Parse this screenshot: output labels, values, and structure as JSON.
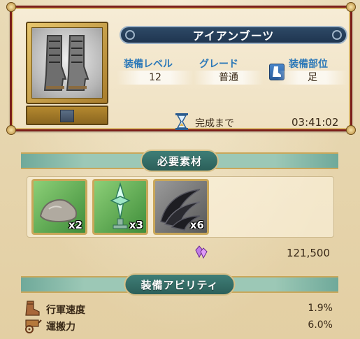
{
  "item": {
    "name": "アイアンブーツ",
    "stats": {
      "level_label": "装備レベル",
      "level_value": "12",
      "grade_label": "グレード",
      "grade_value": "普通",
      "slot_label": "装備部位",
      "slot_value": "足",
      "slot_icon": "boot-icon"
    },
    "timer_label": "完成まで",
    "timer_value": "03:41:02",
    "timer_icon": "hourglass-icon"
  },
  "materials": {
    "header": "必要素材",
    "items": [
      {
        "icon": "stone-icon",
        "qty": "x2"
      },
      {
        "icon": "crystal-icon",
        "qty": "x3"
      },
      {
        "icon": "claw-icon",
        "qty": "x6"
      }
    ],
    "cost_icon": "purple-gem-icon",
    "cost_value": "121,500"
  },
  "abilities": {
    "header": "装備アビリティ",
    "items": [
      {
        "icon": "boot-icon",
        "label": "行軍速度",
        "value": "1.9%"
      },
      {
        "icon": "cart-icon",
        "label": "運搬力",
        "value": "6.0%"
      }
    ]
  },
  "colors": {
    "frame_red": "#7c1f1a",
    "banner_navy": "#1f3550",
    "teal_header": "#2b5f59",
    "stat_label_blue": "#2b78b8"
  }
}
